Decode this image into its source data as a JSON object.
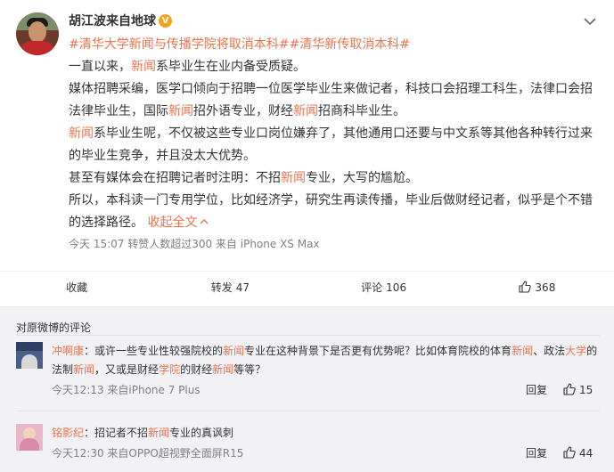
{
  "post": {
    "username": "胡江波来自地球",
    "verified_badge": "V",
    "topics": [
      "#清华大学新闻与传播学院将取消本科#",
      "#清华新传取消本科#"
    ],
    "paragraphs": [
      [
        {
          "t": "一直以来，"
        },
        {
          "t": "新闻",
          "h": true
        },
        {
          "t": "系毕业生在业内备受质疑。"
        }
      ],
      [
        {
          "t": "媒体招聘采编，医学口倾向于招聘一位医学毕业生来做记者，科技口会招理工科生，法律口会招法律毕业生，国际"
        },
        {
          "t": "新闻",
          "h": true
        },
        {
          "t": "招外语专业，财经"
        },
        {
          "t": "新闻",
          "h": true
        },
        {
          "t": "招商科毕业生。"
        }
      ],
      [
        {
          "t": "新闻",
          "h": true
        },
        {
          "t": "系毕业生呢，不仅被这些专业口岗位嫌弃了，其他通用口还要与中文系等其他各种转行过来的毕业生竞争，并且没太大优势。"
        }
      ],
      [
        {
          "t": "甚至有媒体会在招聘记者时注明：不招"
        },
        {
          "t": "新闻",
          "h": true
        },
        {
          "t": "专业，大写的尴尬。"
        }
      ],
      [
        {
          "t": "所以，本科读一门专用学位，比如经济学，研究生再读传播，毕业后做财经记者，似乎是个不错的选择路径。"
        }
      ]
    ],
    "collapse_label": "收起全文",
    "meta": "今天 15:07 转赞人数超过300  来自 iPhone XS Max",
    "actions": {
      "favorite": "收藏",
      "repost_label": "转发",
      "repost_count": "47",
      "comment_label": "评论",
      "comment_count": "106",
      "like_count": "368"
    }
  },
  "comments_section": {
    "title": "对原微博的评论",
    "items": [
      {
        "user": "冲啊康",
        "segments": [
          {
            "t": "：或许一些专业性较强院校的"
          },
          {
            "t": "新闻",
            "h": true
          },
          {
            "t": "专业在这种背景下是否更有优势呢？比如体育院校的体育"
          },
          {
            "t": "新闻",
            "h": true
          },
          {
            "t": "、政法"
          },
          {
            "t": "大学",
            "h": true
          },
          {
            "t": "的法制"
          },
          {
            "t": "新闻",
            "h": true
          },
          {
            "t": "，又或是财经"
          },
          {
            "t": "学院",
            "h": true
          },
          {
            "t": "的财经"
          },
          {
            "t": "新闻",
            "h": true
          },
          {
            "t": "等等？"
          }
        ],
        "meta": "今天12:13 来自iPhone 7 Plus",
        "reply": "回复",
        "likes": "15"
      },
      {
        "user": "铭影纪",
        "segments": [
          {
            "t": "：招记者不招"
          },
          {
            "t": "新闻",
            "h": true
          },
          {
            "t": "专业的真讽刺"
          }
        ],
        "meta": "今天12:30 来自OPPO超视野全面屏R15",
        "reply": "回复",
        "likes": "44"
      }
    ]
  },
  "colors": {
    "accent": "#eb7350",
    "verified": "#f7a21b",
    "meta_gray": "#808080",
    "background": "#f2f2f5"
  }
}
